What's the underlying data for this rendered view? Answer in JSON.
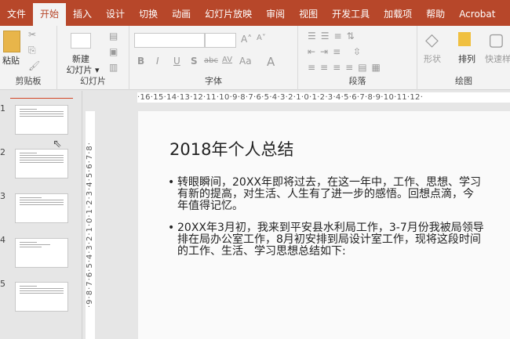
{
  "tabs": [
    "文件",
    "开始",
    "插入",
    "设计",
    "切换",
    "动画",
    "幻灯片放映",
    "审阅",
    "视图",
    "开发工具",
    "加载项",
    "帮助",
    "Acrobat"
  ],
  "ribbon": {
    "clipboard": {
      "paste": "粘贴",
      "label": "剪贴板"
    },
    "slides": {
      "new_slide_1": "新建",
      "new_slide_2": "幻灯片 ▾",
      "label": "幻灯片"
    },
    "font": {
      "label": "字体",
      "bold": "B",
      "italic": "I",
      "underline": "U",
      "shadow": "S",
      "strike": "abc",
      "spacing": "AV",
      "case": "Aa",
      "color": "A",
      "grow": "A˄",
      "shrink": "A˅"
    },
    "paragraph": {
      "label": "段落"
    },
    "drawing": {
      "shapes": "形状",
      "arrange": "排列",
      "quick_styles": "快速样",
      "label": "绘图"
    }
  },
  "thumbnails": [
    "1",
    "2",
    "3",
    "4",
    "5"
  ],
  "hruler": "·16·15·14·13·12·11·10·9·8·7·6·5·4·3·2·1·0·1·2·3·4·5·6·7·8·9·10·11·12·",
  "vruler": "·9·8·7·6·5·4·3·2·1·0·1·2·3·4·5·6·7·8·",
  "slide": {
    "title": "2018年个人总结",
    "bullets": [
      [
        "转眼瞬间，20XX年即将过去，在这一年中，工作、思想、学习",
        "有新的提高，对生活、人生有了进一步的感悟。回想点滴，今",
        "年值得记忆。"
      ],
      [
        "20XX年3月初，我来到平安县水利局工作，3-7月份我被局领导",
        "排在局办公室工作，8月初安排到局设计室工作，现将这段时间",
        "的工作、生活、学习思想总结如下:"
      ]
    ]
  }
}
